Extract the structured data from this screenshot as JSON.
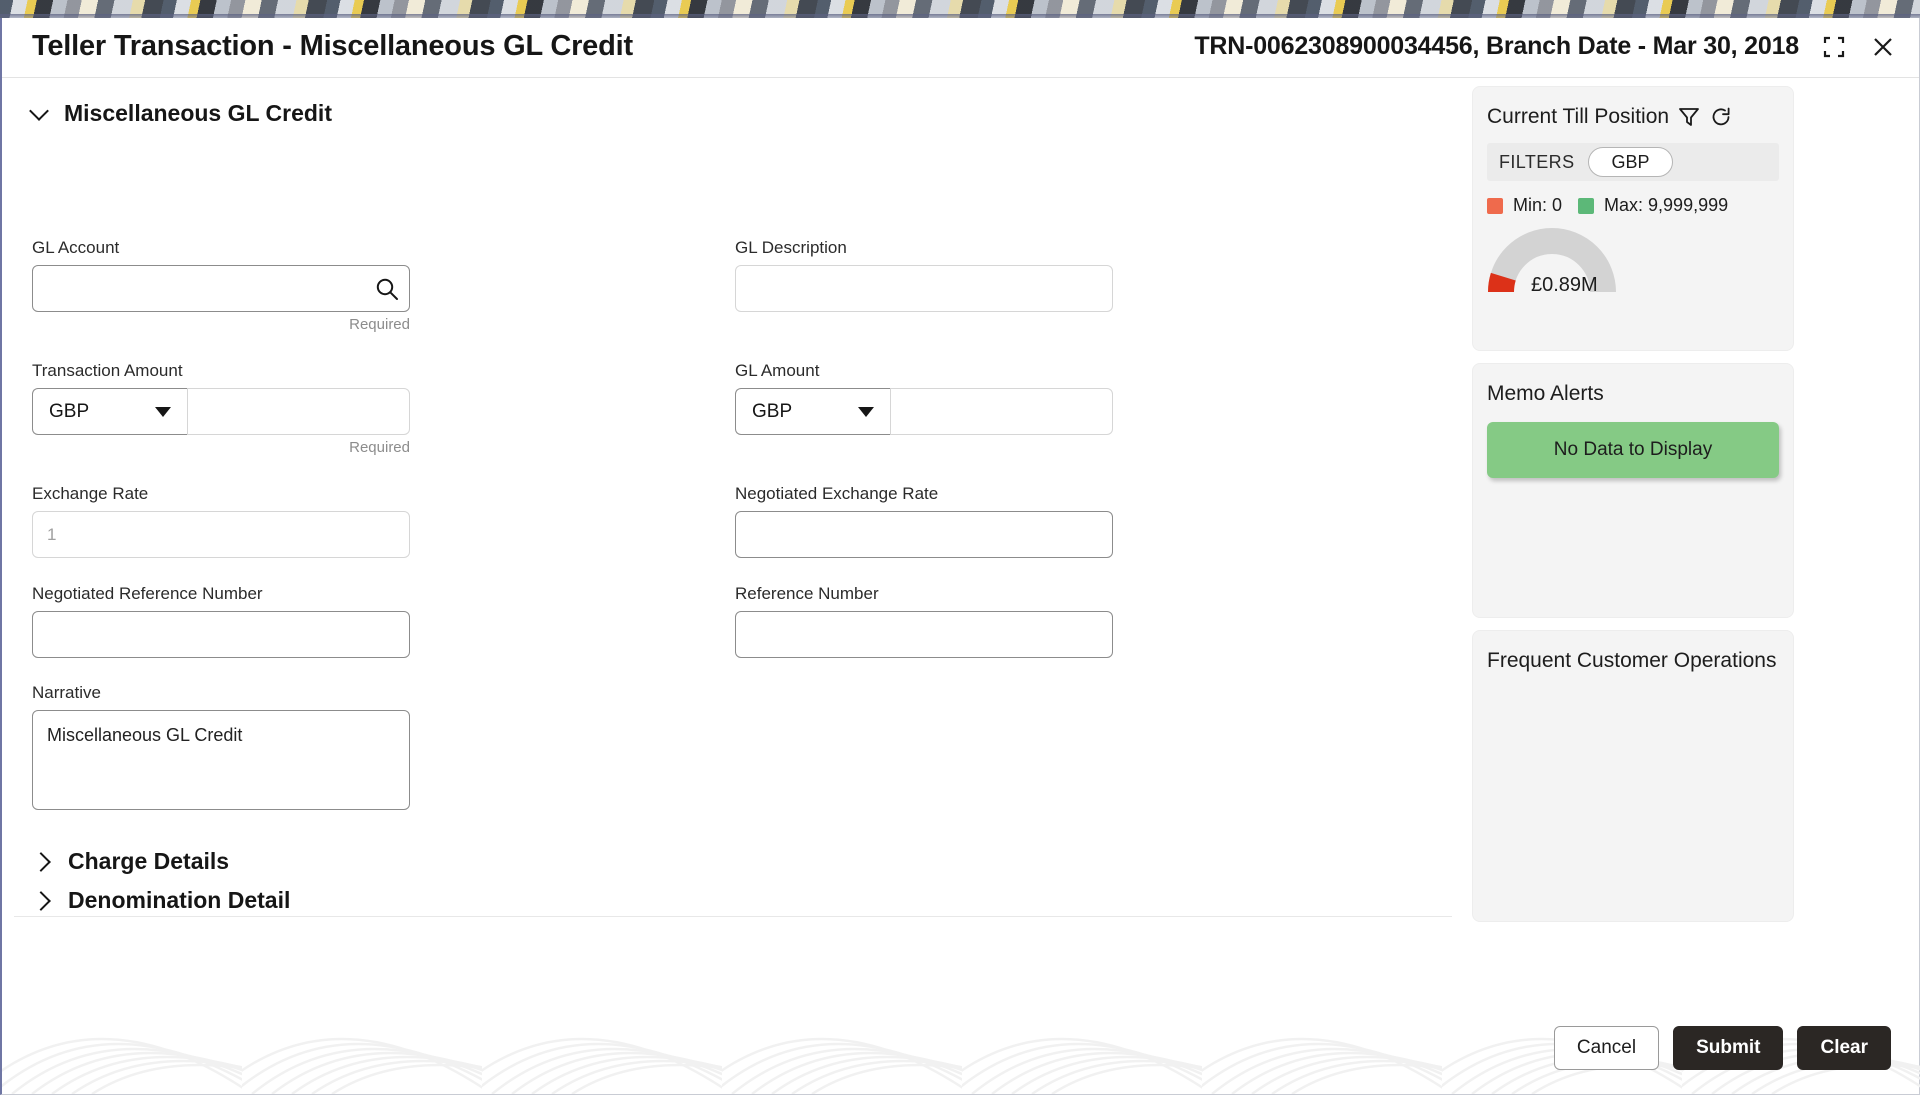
{
  "header": {
    "title": "Teller Transaction - Miscellaneous GL Credit",
    "transaction_info": "TRN-0062308900034456, Branch Date - Mar 30, 2018",
    "minimize_icon": "restore-icon",
    "close_icon": "close-icon"
  },
  "form": {
    "section_title": "Miscellaneous GL Credit",
    "fields": {
      "gl_account": {
        "label": "GL Account",
        "value": "",
        "placeholder": "",
        "helper": "Required",
        "icon": "search-icon"
      },
      "gl_description": {
        "label": "GL Description",
        "value": "",
        "placeholder": ""
      },
      "transaction_amount": {
        "label": "Transaction Amount",
        "currency": "GBP",
        "value": "",
        "placeholder": "",
        "helper": "Required"
      },
      "gl_amount": {
        "label": "GL Amount",
        "currency": "GBP",
        "value": "",
        "placeholder": ""
      },
      "exchange_rate": {
        "label": "Exchange Rate",
        "value": "",
        "placeholder": "1"
      },
      "negotiated_exchange_rate": {
        "label": "Negotiated Exchange Rate",
        "value": "",
        "placeholder": ""
      },
      "negotiated_reference_number": {
        "label": "Negotiated Reference Number",
        "value": "",
        "placeholder": ""
      },
      "reference_number": {
        "label": "Reference Number",
        "value": "",
        "placeholder": ""
      },
      "narrative": {
        "label": "Narrative",
        "value": "Miscellaneous GL Credit",
        "placeholder": ""
      }
    },
    "subsections": [
      {
        "label": "Charge Details",
        "expanded": false
      },
      {
        "label": "Denomination Detail",
        "expanded": false
      }
    ]
  },
  "sidebar": {
    "till": {
      "title": "Current Till Position",
      "filter_icon": "funnel-icon",
      "refresh_icon": "refresh-icon",
      "filters_label": "FILTERS",
      "currency_chip": "GBP",
      "min_label": "Min: 0",
      "max_label": "Max: 9,999,999",
      "min_color": "#ef6a4c",
      "max_color": "#5cb878",
      "gauge_value": "£0.89M",
      "gauge_fill_color": "#dc3118",
      "gauge_track_color": "#d3d3d3"
    },
    "memo": {
      "title": "Memo Alerts",
      "banner_text": "No Data to Display",
      "banner_color": "#85ca85"
    },
    "frequent": {
      "title": "Frequent Customer Operations"
    }
  },
  "footer": {
    "cancel_label": "Cancel",
    "submit_label": "Submit",
    "clear_label": "Clear"
  },
  "chart_data": {
    "type": "gauge",
    "title": "Current Till Position",
    "value": 890000,
    "value_label": "£0.89M",
    "min": 0,
    "max": 9999999,
    "min_label": "Min: 0",
    "max_label": "Max: 9,999,999",
    "unit": "GBP",
    "fill_color": "#dc3118",
    "track_color": "#d3d3d3",
    "legend": [
      {
        "name": "Min: 0",
        "color": "#ef6a4c"
      },
      {
        "name": "Max: 9,999,999",
        "color": "#5cb878"
      }
    ],
    "legend_position": "top"
  }
}
